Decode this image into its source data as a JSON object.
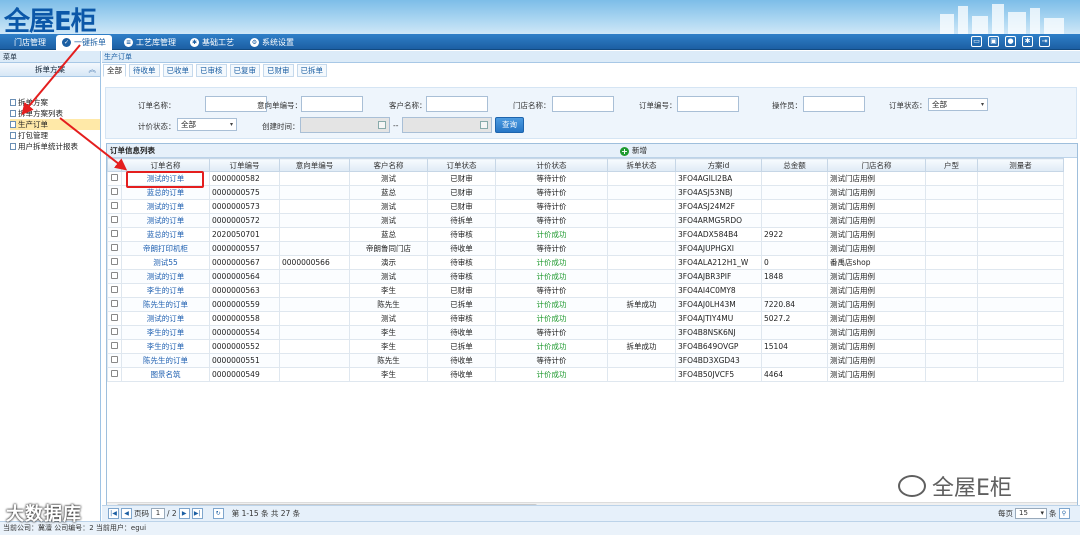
{
  "header": {
    "logo": "全屋E柜"
  },
  "nav": [
    {
      "label": "门店管理",
      "icon": "store-icon"
    },
    {
      "label": "一键拆单",
      "icon": "check-icon",
      "active": true
    },
    {
      "label": "工艺库管理",
      "icon": "library-icon"
    },
    {
      "label": "基础工艺",
      "icon": "gear-icon"
    },
    {
      "label": "系统设置",
      "icon": "settings-icon"
    }
  ],
  "sidebar": {
    "title": "菜单",
    "section": "拆单方案",
    "items": [
      "拆单方案",
      "拆单方案列表",
      "生产订单",
      "打包管理",
      "用户拆单统计报表"
    ]
  },
  "main": {
    "breadcrumb": "生产订单",
    "tabs": [
      "全部",
      "待收单",
      "已收单",
      "已审核",
      "已复审",
      "已财审",
      "已拆单"
    ]
  },
  "filter": {
    "order_name": "订单名称：",
    "intent_no": "意向单编号：",
    "customer": "客户名称：",
    "store": "门店名称：",
    "order_no": "订单编号：",
    "operator": "操作员：",
    "order_status": "订单状态：",
    "order_status_val": "全部",
    "price_status": "计价状态：",
    "price_status_val": "全部",
    "created": "创建时间：",
    "range_sep": "--",
    "query": "查询"
  },
  "grid": {
    "title": "订单信息列表",
    "add": "新增",
    "columns": [
      "订单名称",
      "订单编号",
      "意向单编号",
      "客户名称",
      "订单状态",
      "计价状态",
      "拆单状态",
      "方案id",
      "总金额",
      "门店名称",
      "户型",
      "测量者"
    ],
    "rows": [
      [
        "测试的订单",
        "0000000582",
        "",
        "测试",
        "已财审",
        "等待计价",
        "",
        "3FO4AGILI2BA",
        "",
        "测试门店用例",
        "",
        ""
      ],
      [
        "蓝总的订单",
        "0000000575",
        "",
        "蓝总",
        "已财审",
        "等待计价",
        "",
        "3FO4ASJ53NBJ",
        "",
        "测试门店用例",
        "",
        ""
      ],
      [
        "测试的订单",
        "0000000573",
        "",
        "测试",
        "已财审",
        "等待计价",
        "",
        "3FO4ASJ24M2F",
        "",
        "测试门店用例",
        "",
        ""
      ],
      [
        "测试的订单",
        "0000000572",
        "",
        "测试",
        "待拆单",
        "等待计价",
        "",
        "3FO4ARMG5RDO",
        "",
        "测试门店用例",
        "",
        ""
      ],
      [
        "蓝总的订单",
        "2020050701",
        "",
        "蓝总",
        "待审核",
        "计价成功",
        "",
        "3FO4ADX584B4",
        "2922",
        "测试门店用例",
        "",
        ""
      ],
      [
        "帝朗打印机柜",
        "0000000557",
        "",
        "帝朗鲁同门店",
        "待收单",
        "等待计价",
        "",
        "3FO4AJUPHGXI",
        "",
        "测试门店用例",
        "",
        ""
      ],
      [
        "测试55",
        "0000000567",
        "0000000566",
        "演示",
        "待审核",
        "计价成功",
        "",
        "3FO4ALA212H1_W",
        "0",
        "番禹店shop",
        "",
        ""
      ],
      [
        "测试的订单",
        "0000000564",
        "",
        "测试",
        "待审核",
        "计价成功",
        "",
        "3FO4AJBR3PIF",
        "1848",
        "测试门店用例",
        "",
        ""
      ],
      [
        "李生的订单",
        "0000000563",
        "",
        "李生",
        "已财审",
        "等待计价",
        "",
        "3FO4AI4C0MY8",
        "",
        "测试门店用例",
        "",
        ""
      ],
      [
        "陈先生的订单",
        "0000000559",
        "",
        "陈先生",
        "已拆单",
        "计价成功",
        "拆单成功",
        "3FO4AJ0LH43M",
        "7220.84",
        "测试门店用例",
        "",
        ""
      ],
      [
        "测试的订单",
        "0000000558",
        "",
        "测试",
        "待审核",
        "计价成功",
        "",
        "3FO4AJTIY4MU",
        "5027.2",
        "测试门店用例",
        "",
        ""
      ],
      [
        "李生的订单",
        "0000000554",
        "",
        "李生",
        "待收单",
        "等待计价",
        "",
        "3FO4B8NSK6NJ",
        "",
        "测试门店用例",
        "",
        ""
      ],
      [
        "李生的订单",
        "0000000552",
        "",
        "李生",
        "已拆单",
        "计价成功",
        "拆单成功",
        "3FO4B649OVGP",
        "15104",
        "测试门店用例",
        "",
        ""
      ],
      [
        "陈先生的订单",
        "0000000551",
        "",
        "陈先生",
        "待收单",
        "等待计价",
        "",
        "3FO4BD3XGD43",
        "",
        "测试门店用例",
        "",
        ""
      ],
      [
        "图景名筑",
        "0000000549",
        "",
        "李生",
        "待收单",
        "计价成功",
        "",
        "3FO4B50JVCF5",
        "4464",
        "测试门店用例",
        "",
        ""
      ]
    ]
  },
  "pager": {
    "page_label": "页码",
    "page": "1",
    "total_pages": "/ 2",
    "summary": "第 1-15 条 共 27 条",
    "per_page_label": "每页",
    "per_page": "15",
    "unit": "条"
  },
  "status": {
    "text": "当前公司：冀澶   公司编号：2    当前用户：egui"
  },
  "watermarks": {
    "right": "全屋E柜",
    "left": "大数据库"
  }
}
